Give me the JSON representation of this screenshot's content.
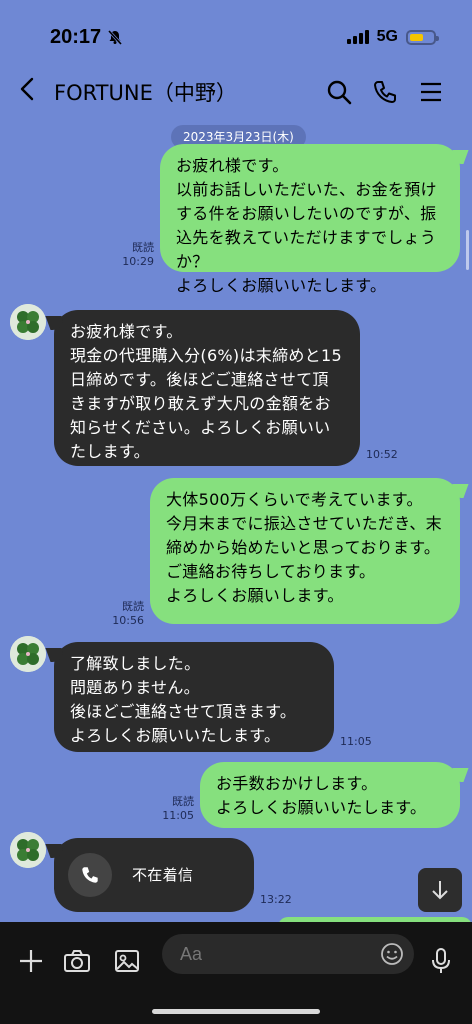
{
  "status": {
    "time": "20:17",
    "network": "5G"
  },
  "header": {
    "title": "FORTUNE（中野）",
    "back": "＜"
  },
  "date_chip": "2023年3月23日(木)",
  "messages": [
    {
      "text": "お疲れ様です。\n以前お話しいただいた、お金を預けする件をお願いしたいのですが、振込先を教えていただけますでしょうか？\nよろしくお願いいたします。",
      "read": "既読",
      "time": "10:29"
    },
    {
      "text": "お疲れ様です。\n現金の代理購入分(6%)は末締めと15日締めです。後ほどご連絡させて頂きますが取り敢えず大凡の金額をお知らせください。よろしくお願いいたします。",
      "time": "10:52"
    },
    {
      "text": "大体500万くらいで考えています。\n今月末までに振込させていただき、末締めから始めたいと思っております。\nご連絡お待ちしております。\nよろしくお願いします。",
      "read": "既読",
      "time": "10:56"
    },
    {
      "text": "了解致しました。\n問題ありません。\n後ほどご連絡させて頂きます。\nよろしくお願いいたします。",
      "time": "11:05"
    },
    {
      "text": "お手数おかけします。\nよろしくお願いいたします。",
      "read": "既読",
      "time": "11:05"
    },
    {
      "text": "不在着信",
      "time": "13:22"
    }
  ],
  "input": {
    "placeholder": "Aa"
  },
  "icons": [
    "back-icon",
    "search-icon",
    "phone-icon",
    "menu-icon",
    "plus-icon",
    "camera-icon",
    "image-icon",
    "emoji-icon",
    "mic-icon",
    "scroll-down-icon",
    "missed-call-icon",
    "avatar"
  ]
}
